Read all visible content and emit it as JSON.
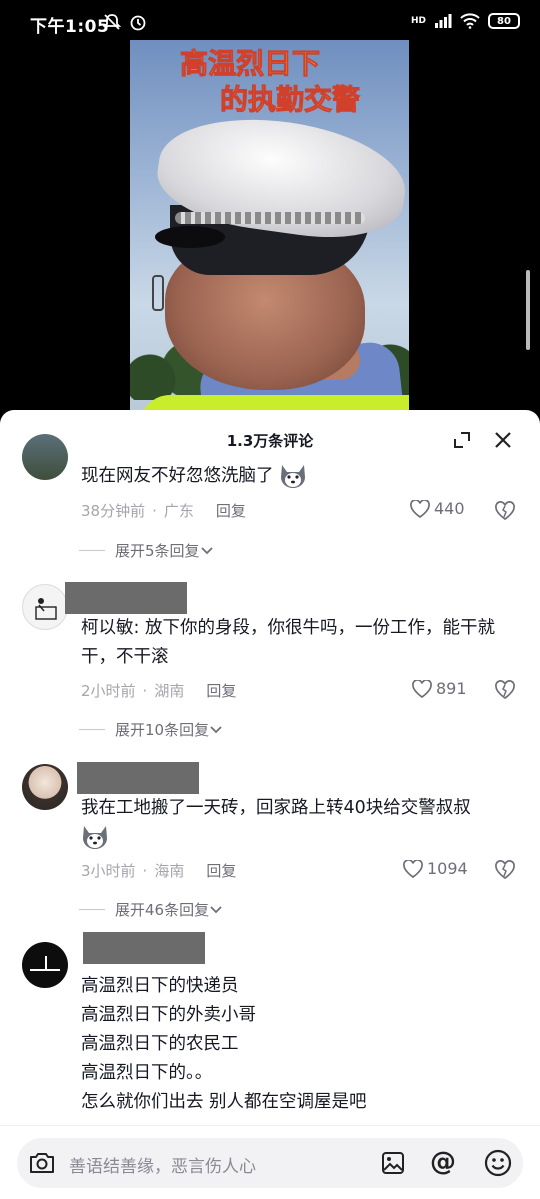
{
  "status_bar": {
    "time": "下午1:05",
    "network": "HD",
    "battery": "80"
  },
  "video": {
    "title_line1": "高温烈日下",
    "title_line2": "的执勤交警"
  },
  "comments_panel": {
    "title": "1.3万条评论",
    "comments": [
      {
        "text": "现在网友不好忽悠洗脑了",
        "time": "38分钟前",
        "location": "广东",
        "reply_label": "回复",
        "likes": "440",
        "expand_label": "展开5条回复"
      },
      {
        "text": "柯以敏: 放下你的身段，你很牛吗，一份工作，能干就干，不干滚",
        "time": "2小时前",
        "location": "湖南",
        "reply_label": "回复",
        "likes": "891",
        "expand_label": "展开10条回复"
      },
      {
        "text": "我在工地搬了一天砖，回家路上转40块给交警叔叔",
        "time": "3小时前",
        "location": "海南",
        "reply_label": "回复",
        "likes": "1094",
        "expand_label": "展开46条回复"
      },
      {
        "lines": [
          "高温烈日下的快递员",
          "高温烈日下的外卖小哥",
          "高温烈日下的农民工",
          "高温烈日下的。。",
          "怎么就你们出去 别人都在空调屋是吧"
        ]
      }
    ]
  },
  "input_bar": {
    "placeholder": "善语结善缘，恶言伤人心",
    "at_symbol": "@"
  },
  "colors": {
    "text_primary": "#161823",
    "text_secondary": "#a5a5ad",
    "redaction": "#6b6b6b"
  }
}
